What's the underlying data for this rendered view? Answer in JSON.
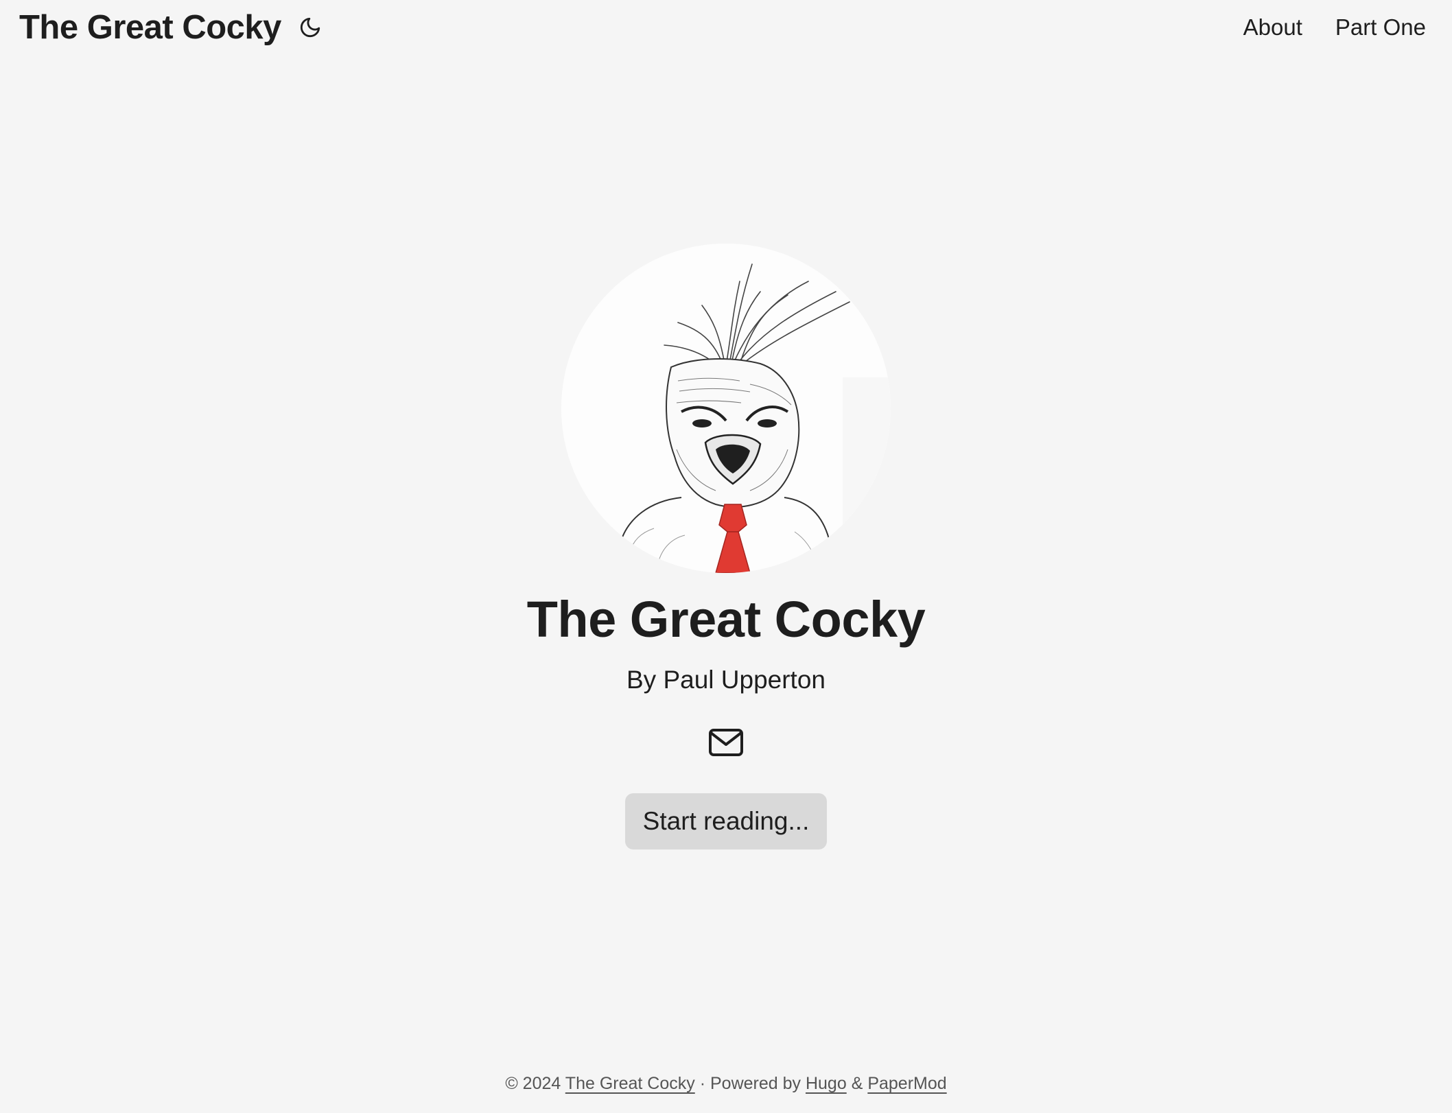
{
  "header": {
    "logo": "The Great Cocky",
    "theme_toggle_icon": "moon-icon",
    "nav": [
      {
        "label": "About"
      },
      {
        "label": "Part One"
      }
    ]
  },
  "hero": {
    "avatar_icon": "rooster-sketch-image",
    "title": "The Great Cocky",
    "subtitle": "By Paul Upperton",
    "social_icon": "email-icon",
    "button_label": "Start reading..."
  },
  "footer": {
    "copyright": "© 2024",
    "site_link": "The Great Cocky",
    "separator": "·",
    "powered_by": "Powered by",
    "hugo_link": "Hugo",
    "amp": "&",
    "theme_link": "PaperMod"
  },
  "colors": {
    "background": "#f5f5f5",
    "text": "#1e1e1e",
    "button_bg": "#d9d9d9",
    "tie_red": "#e03a32"
  }
}
